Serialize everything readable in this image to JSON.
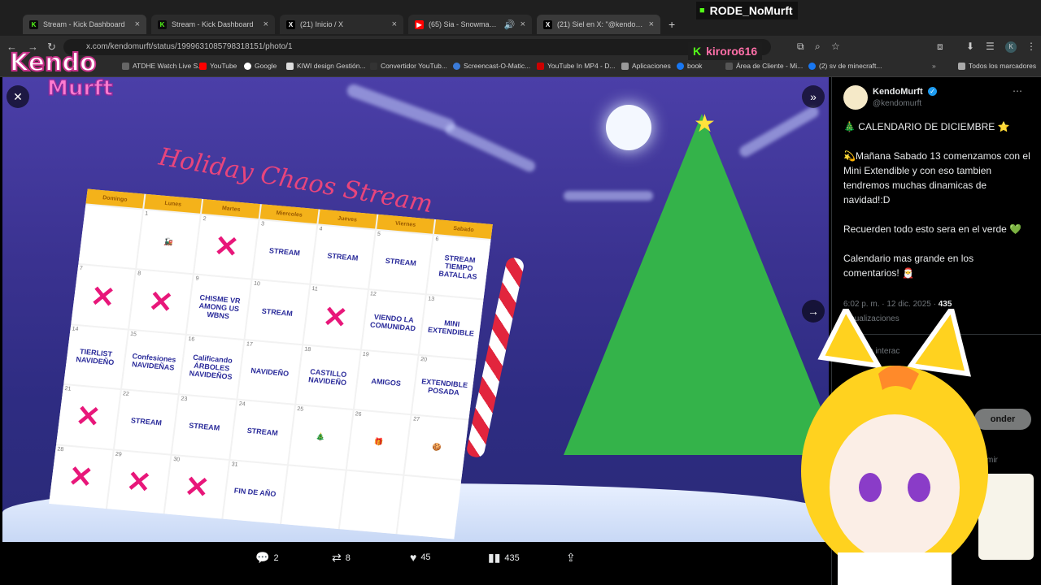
{
  "tabs": [
    {
      "label": "Stream - Kick Dashboard",
      "icon": "kick-icon",
      "color": "#53fc18"
    },
    {
      "label": "Stream - Kick Dashboard",
      "icon": "kick-icon",
      "color": "#53fc18"
    },
    {
      "label": "(21) Inicio / X",
      "icon": "x-icon",
      "color": "#ffffff"
    },
    {
      "label": "(65) Sia - Snowman [Official",
      "icon": "youtube-icon",
      "color": "#ff0000"
    },
    {
      "label": "(21) Siel en X: \"@kendomurft N",
      "icon": "x-icon",
      "color": "#ffffff"
    }
  ],
  "address_bar": {
    "url": "x.com/kendomurft/status/1999631085798318151/photo/1"
  },
  "bookmarks": [
    {
      "label": "ATDHE Watch Live S...",
      "color": "#666666"
    },
    {
      "label": "YouTube",
      "color": "#ff0000"
    },
    {
      "label": "Google",
      "color": "#ffffff"
    },
    {
      "label": "KIWI design Gestión...",
      "color": "#dddddd"
    },
    {
      "label": "Convertidor YouTub...",
      "color": "#333333"
    },
    {
      "label": "Screencast-O-Matic...",
      "color": "#3b7bd8"
    },
    {
      "label": "YouTube In MP4 - D...",
      "color": "#cc0000"
    },
    {
      "label": "Aplicaciones",
      "color": "#999999"
    },
    {
      "label": "book",
      "color": "#1877f2"
    },
    {
      "label": "Área de Cliente - Mi...",
      "color": "#555555"
    },
    {
      "label": "(2) sv de minecraft...",
      "color": "#1877f2"
    },
    {
      "label": "Todos los marcadores",
      "color": "#aaaaaa"
    }
  ],
  "overlay": {
    "rode_label": "RODE_NoMurft",
    "kiroro_label": "kiroro616",
    "logo_text": "Kendo Murft"
  },
  "calendar": {
    "title": "Holiday Chaos Stream",
    "weekdays": [
      "Domingo",
      "Lunes",
      "Martes",
      "Miercoles",
      "Jueves",
      "Viernes",
      "Sabado"
    ],
    "cells": [
      {
        "day": "",
        "text": ""
      },
      {
        "day": "1",
        "text": "🚂"
      },
      {
        "day": "2",
        "text": "✕"
      },
      {
        "day": "3",
        "text": "STREAM"
      },
      {
        "day": "4",
        "text": "STREAM"
      },
      {
        "day": "5",
        "text": "STREAM"
      },
      {
        "day": "6",
        "text": "STREAM TIEMPO BATALLAS"
      },
      {
        "day": "7",
        "text": "✕"
      },
      {
        "day": "8",
        "text": "✕"
      },
      {
        "day": "9",
        "text": "CHISME VR AMONG US WBNS"
      },
      {
        "day": "10",
        "text": "STREAM"
      },
      {
        "day": "11",
        "text": "✕"
      },
      {
        "day": "12",
        "text": "VIENDO LA COMUNIDAD"
      },
      {
        "day": "13",
        "text": "MINI EXTENDIBLE"
      },
      {
        "day": "14",
        "text": "TIERLIST NAVIDEÑO"
      },
      {
        "day": "15",
        "text": "Confesiones NAVIDEÑAS"
      },
      {
        "day": "16",
        "text": "Calificando ÁRBOLES NAVIDEÑOS"
      },
      {
        "day": "17",
        "text": "NAVIDEÑO"
      },
      {
        "day": "18",
        "text": "CASTILLO NAVIDEÑO"
      },
      {
        "day": "19",
        "text": "AMIGOS"
      },
      {
        "day": "20",
        "text": "EXTENDIBLE POSADA"
      },
      {
        "day": "21",
        "text": "✕"
      },
      {
        "day": "22",
        "text": "STREAM"
      },
      {
        "day": "23",
        "text": "STREAM"
      },
      {
        "day": "24",
        "text": "STREAM"
      },
      {
        "day": "25",
        "text": "🎄"
      },
      {
        "day": "26",
        "text": "🎁"
      },
      {
        "day": "27",
        "text": "🍪"
      },
      {
        "day": "28",
        "text": "✕"
      },
      {
        "day": "29",
        "text": "✕"
      },
      {
        "day": "30",
        "text": "✕"
      },
      {
        "day": "31",
        "text": "FIN DE AÑO"
      },
      {
        "day": "",
        "text": ""
      },
      {
        "day": "",
        "text": ""
      },
      {
        "day": "",
        "text": ""
      }
    ]
  },
  "actions": [
    {
      "icon": "reply-icon",
      "count": "2"
    },
    {
      "icon": "repost-icon",
      "count": "8"
    },
    {
      "icon": "like-icon",
      "count": "45"
    },
    {
      "icon": "views-icon",
      "count": "435"
    },
    {
      "icon": "share-icon",
      "count": ""
    }
  ],
  "post": {
    "author_name": "KendoMurft",
    "author_handle": "@kendomurft",
    "body": "🎄 CALENDARIO DE DICIEMBRE ⭐\n\n💫Mañana Sabado 13 comenzamos con el Mini Extendible y con eso tambien tendremos muchas dinamicas de navidad!:D\n\nRecuerden todo esto sera en el verde 💚\n\nCalendario mas grande en los comentarios! 🎅",
    "timestamp": "6:02 p. m. · 12 dic. 2025 · ",
    "views_count": "435",
    "views_label": "Visualizaciones",
    "partial_text": "as interac",
    "reply_button": "onder",
    "partial_author": "mir"
  }
}
